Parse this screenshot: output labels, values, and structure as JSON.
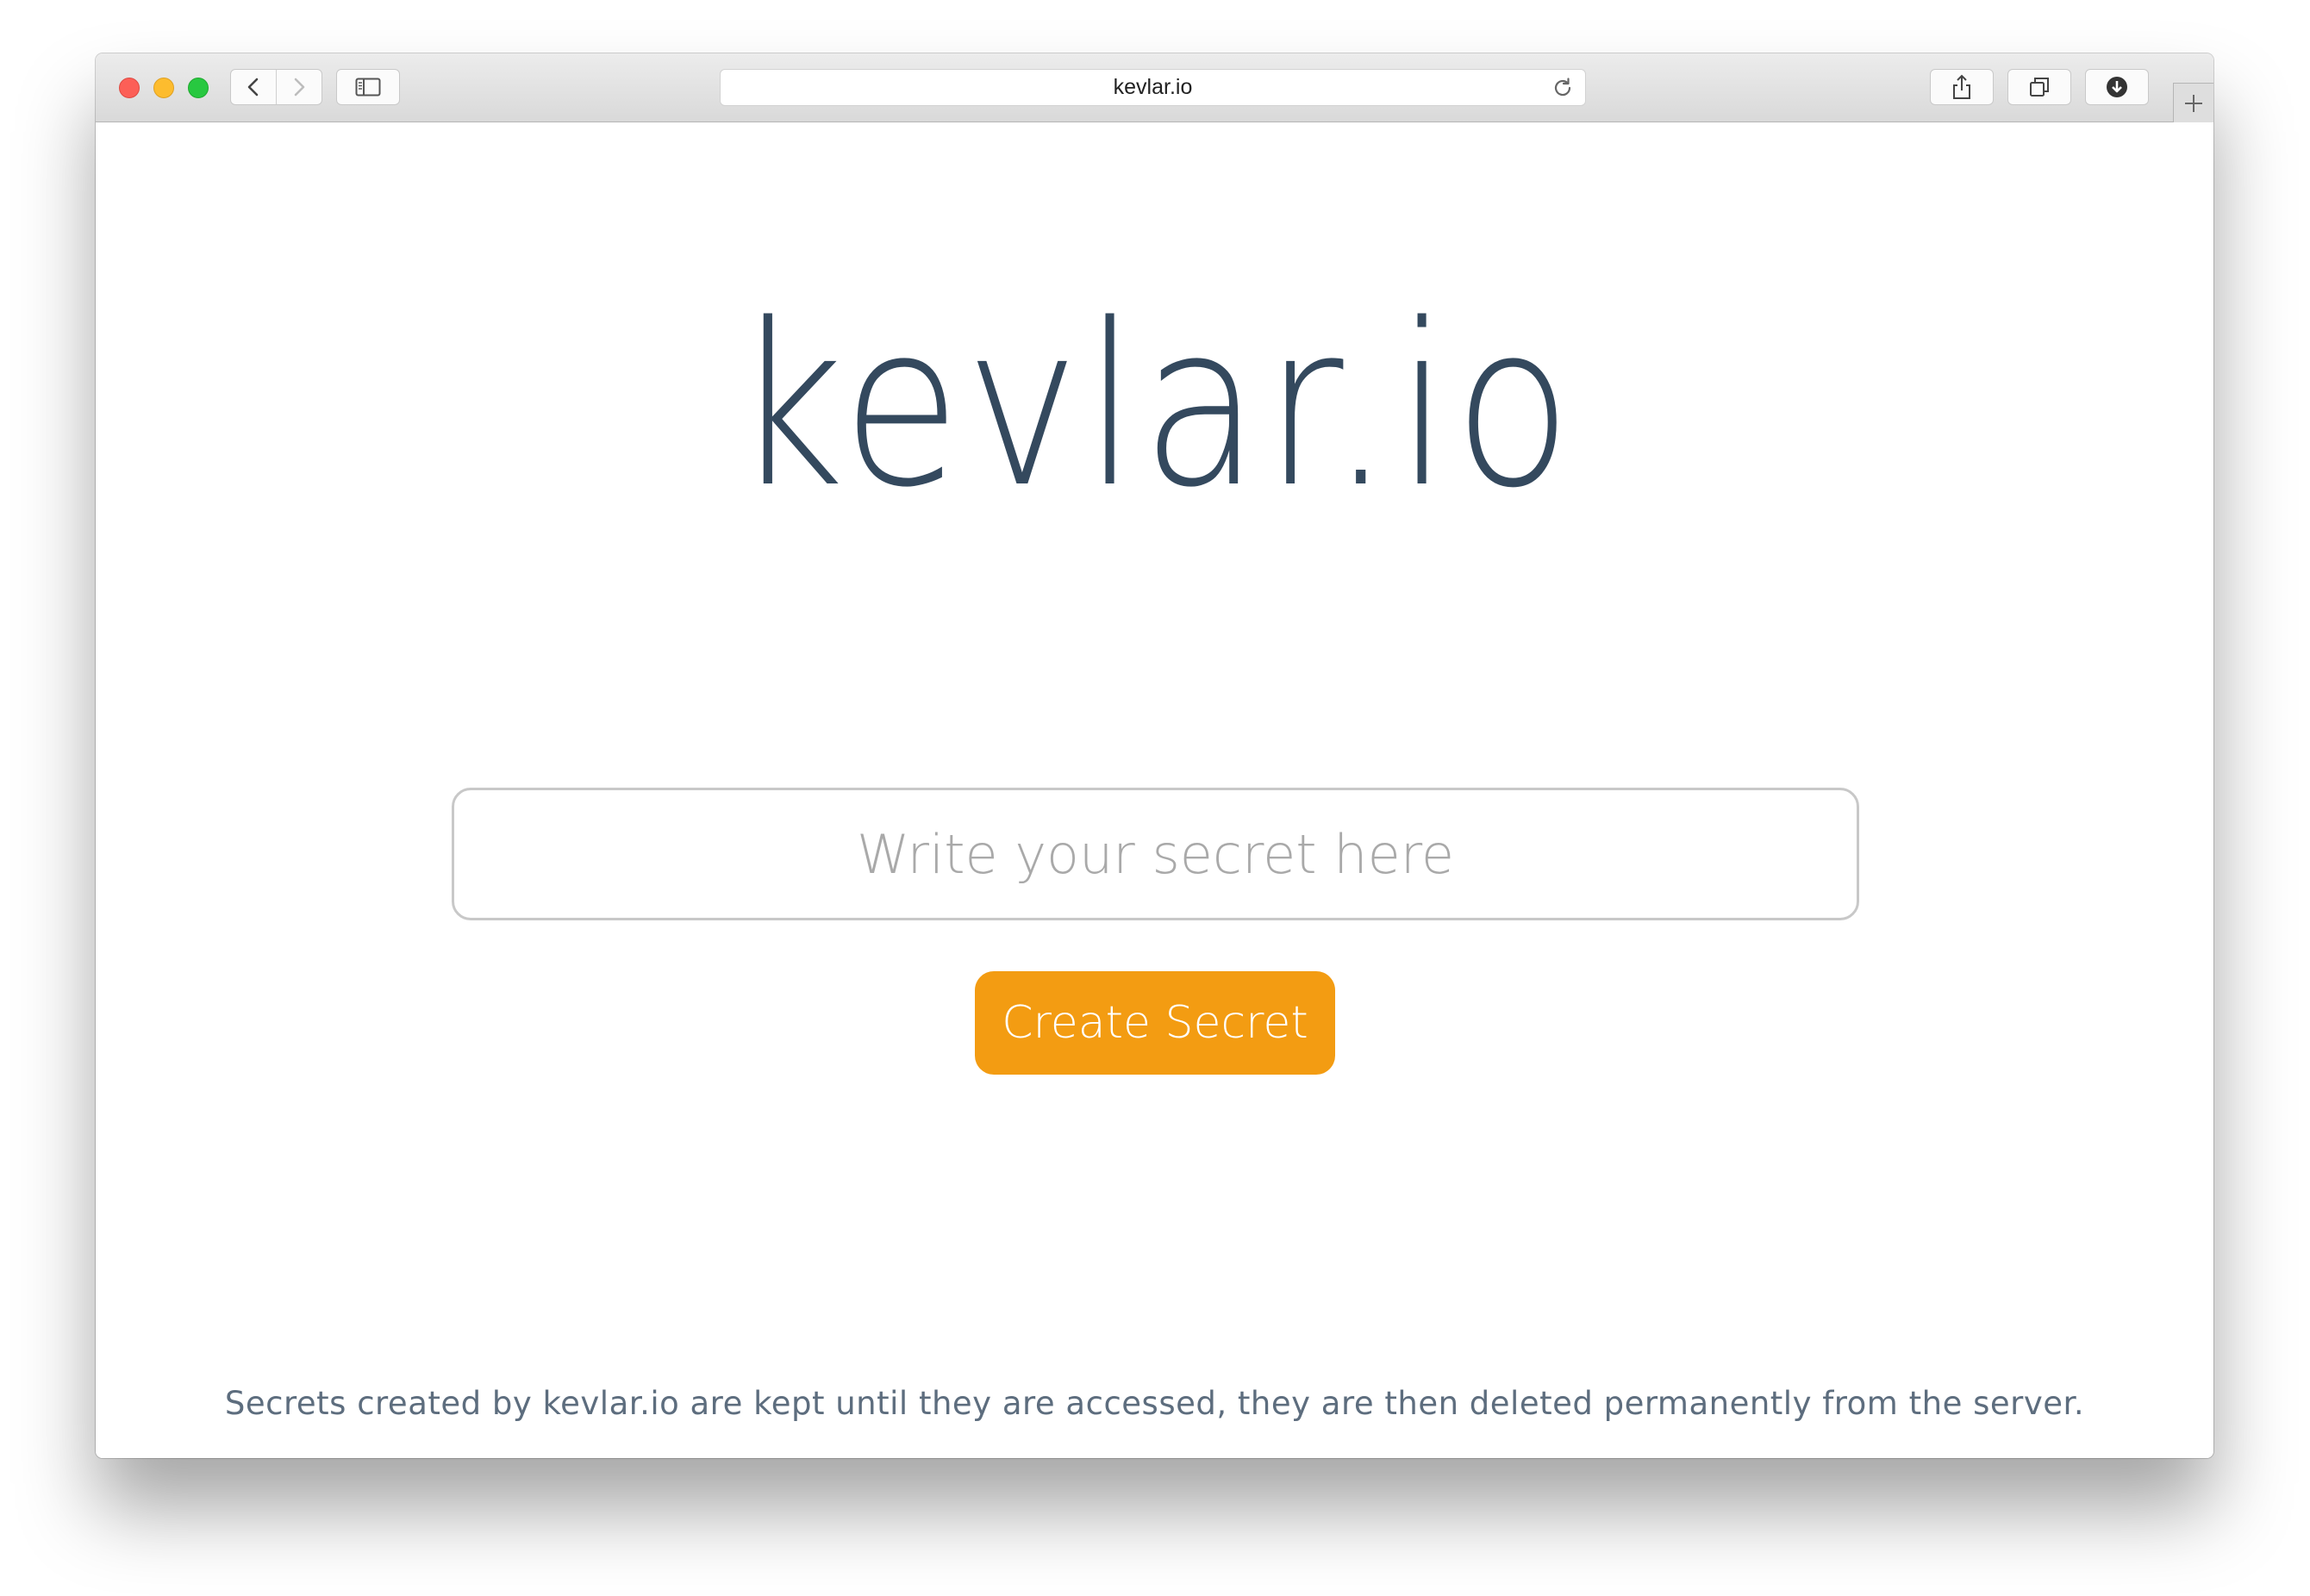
{
  "browser": {
    "url": "kevlar.io",
    "icons": {
      "back": "chevron-left-icon",
      "forward": "chevron-right-icon",
      "sidebar": "sidebar-icon",
      "reload": "reload-icon",
      "share": "share-icon",
      "tabs": "tabs-overview-icon",
      "downloads": "download-icon",
      "new_tab": "plus-icon"
    }
  },
  "page": {
    "logo": "kevlar.io",
    "secret_input": {
      "placeholder": "Write your secret here",
      "value": ""
    },
    "create_button_label": "Create Secret",
    "footer_note": "Secrets created by kevlar.io are kept until they are accessed, they are then deleted permanently from the server."
  },
  "colors": {
    "logo": "#34495e",
    "button": "#f39c12",
    "button_text": "#ffffff",
    "input_border": "#c8c8c8",
    "footer_text": "#5d6d7e"
  }
}
